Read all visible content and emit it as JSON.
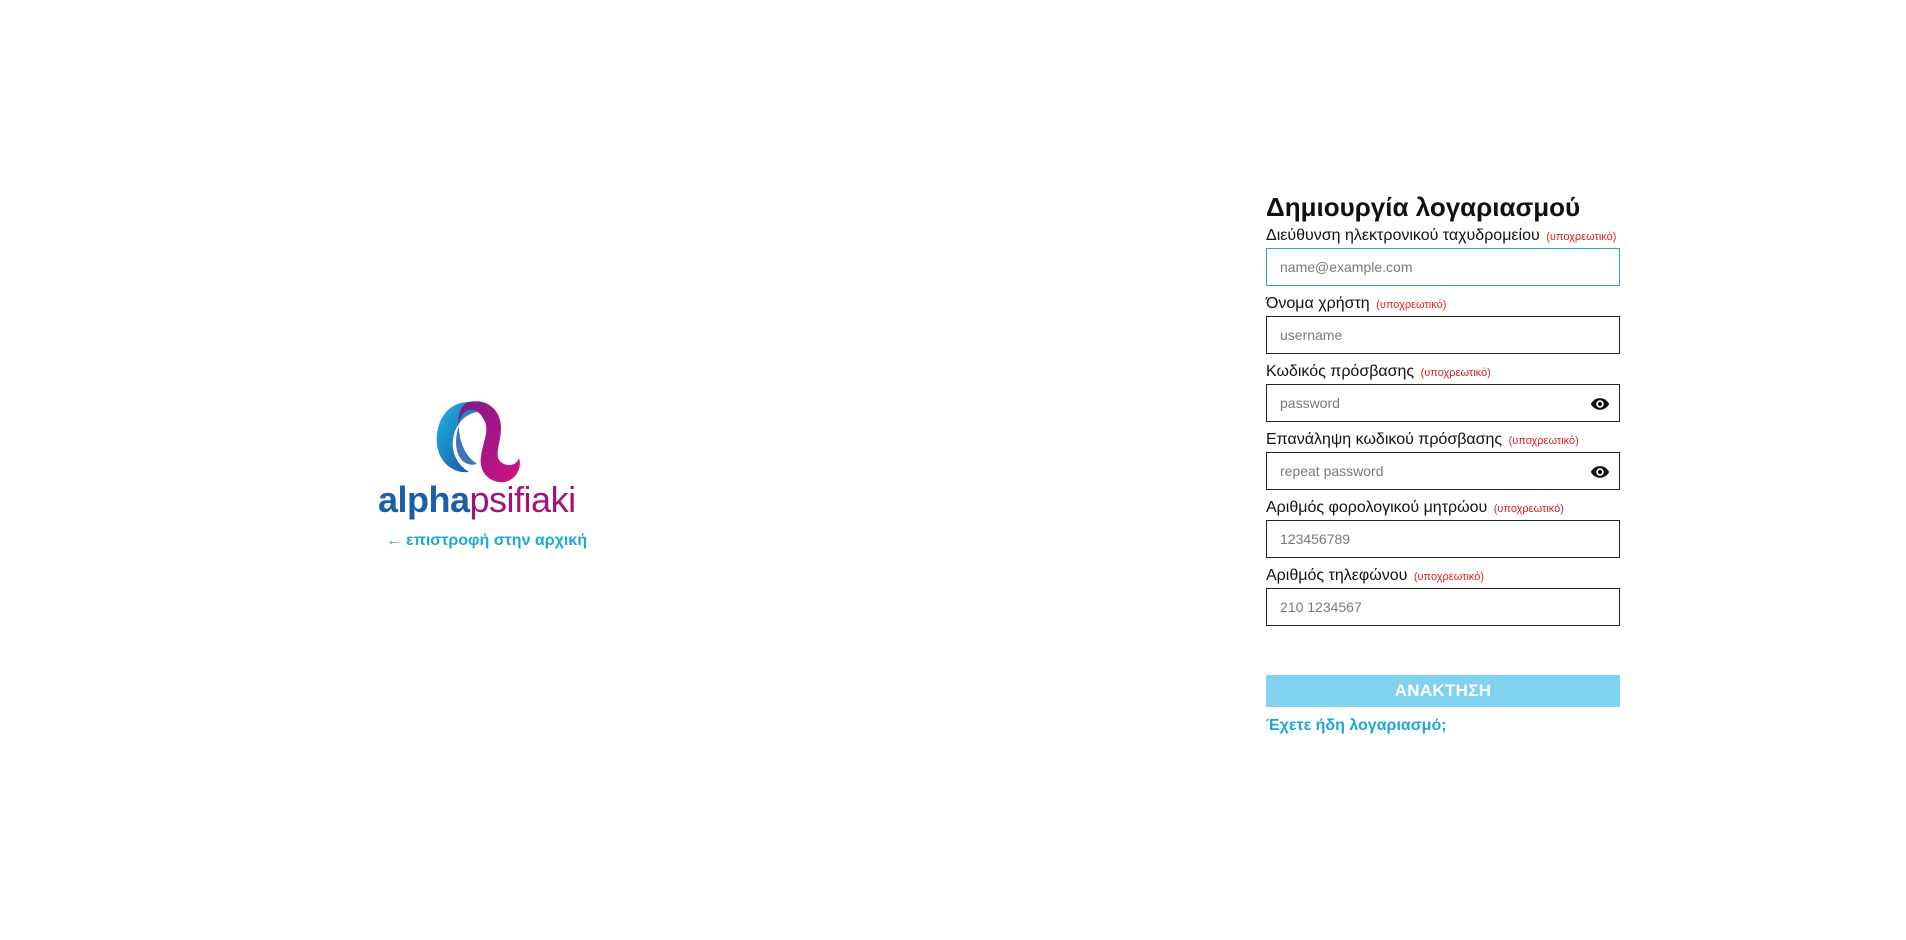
{
  "brand": {
    "name_part1": "alpha",
    "name_part2": "psifiaki",
    "back_link": "επιστροφή στην αρχική",
    "colors": {
      "blue": "#1a5fa8",
      "magenta": "#a0137a",
      "cyan": "#1ea6d8"
    }
  },
  "form": {
    "title": "Δημιουργία λογαριασμού",
    "required_tag": "(υποχρεωτικό)",
    "fields": {
      "email": {
        "label": "Διεύθυνση ηλεκτρονικού ταχυδρομείου",
        "placeholder": "name@example.com",
        "value": ""
      },
      "username": {
        "label": "Όνομα χρήστη",
        "placeholder": "username",
        "value": ""
      },
      "password": {
        "label": "Κωδικός πρόσβασης",
        "placeholder": "password",
        "value": ""
      },
      "repeat_password": {
        "label": "Επανάληψη κωδικού πρόσβασης",
        "placeholder": "repeat password",
        "value": ""
      },
      "tax_id": {
        "label": "Αριθμός φορολογικού μητρώου",
        "placeholder": "123456789",
        "value": ""
      },
      "phone": {
        "label": "Αριθμός τηλεφώνου",
        "placeholder": "210 1234567",
        "value": ""
      }
    },
    "submit_label": "ΑΝΑΚΤΗΣΗ",
    "login_link": "Έχετε ήδη λογαριασμό;",
    "colors": {
      "accent": "#1ea6d8",
      "button": "#7fd3f1",
      "required": "#e02020"
    }
  }
}
